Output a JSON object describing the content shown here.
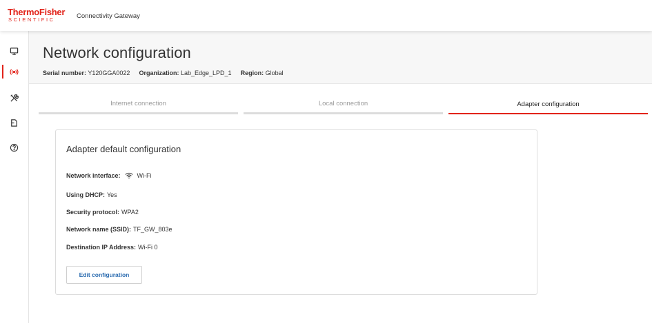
{
  "brand": {
    "line1": "ThermoFisher",
    "line2": "SCIENTIFIC"
  },
  "header": {
    "app_title": "Connectivity Gateway"
  },
  "sidenav": {
    "items": [
      {
        "icon": "monitor-icon",
        "active": false
      },
      {
        "icon": "network-signal-icon",
        "active": true
      },
      {
        "icon": "tools-icon",
        "active": false
      },
      {
        "icon": "document-icon",
        "active": false
      },
      {
        "icon": "help-icon",
        "active": false
      }
    ]
  },
  "page": {
    "title": "Network configuration",
    "serial_label": "Serial number:",
    "serial_value": "Y120GGA0022",
    "org_label": "Organization:",
    "org_value": "Lab_Edge_LPD_1",
    "region_label": "Region:",
    "region_value": "Global"
  },
  "tabs": [
    {
      "label": "Internet connection",
      "active": false
    },
    {
      "label": "Local connection",
      "active": false
    },
    {
      "label": "Adapter configuration",
      "active": true
    }
  ],
  "card": {
    "title": "Adapter default configuration",
    "fields": [
      {
        "label": "Network interface:",
        "value": "Wi-Fi",
        "icon": "wifi-icon"
      },
      {
        "label": "Using DHCP:",
        "value": "Yes"
      },
      {
        "label": "Security protocol:",
        "value": "WPA2"
      },
      {
        "label": "Network name (SSID):",
        "value": "TF_GW_803e"
      },
      {
        "label": "Destination IP Address:",
        "value": "Wi-Fi 0"
      }
    ],
    "edit_button_label": "Edit configuration"
  },
  "colors": {
    "brand_red": "#e2231a",
    "button_text": "#2b6cb0"
  }
}
